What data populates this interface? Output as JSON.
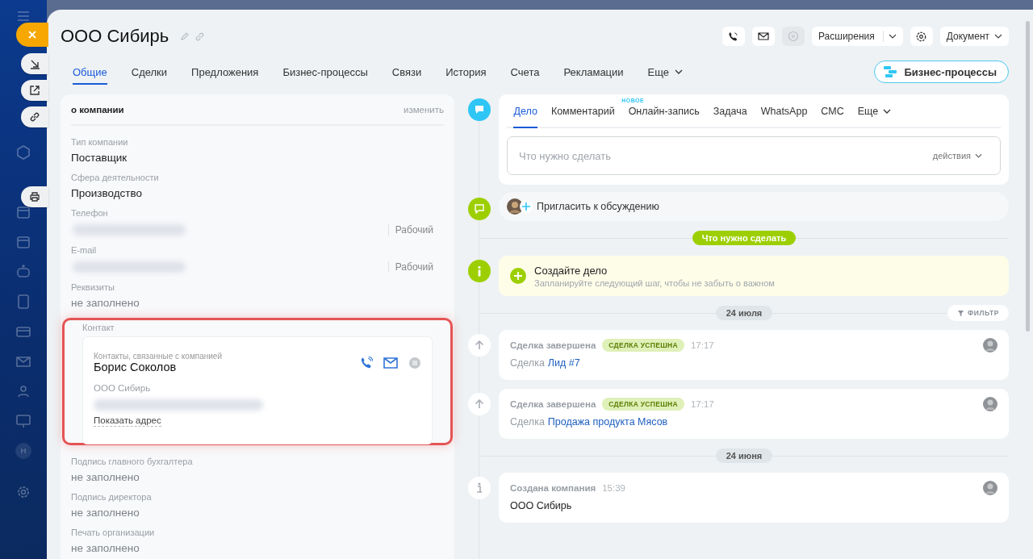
{
  "sidebar": {
    "user_initial": "Н"
  },
  "header": {
    "title": "ООО Сибирь",
    "extensions_button": "Расширения",
    "document_button": "Документ"
  },
  "tabs": [
    {
      "label": "Общие",
      "selected": true
    },
    {
      "label": "Сделки",
      "selected": false
    },
    {
      "label": "Предложения",
      "selected": false
    },
    {
      "label": "Бизнес-процессы",
      "selected": false
    },
    {
      "label": "Связи",
      "selected": false
    },
    {
      "label": "История",
      "selected": false
    },
    {
      "label": "Счета",
      "selected": false
    },
    {
      "label": "Рекламации",
      "selected": false
    },
    {
      "label": "Еще",
      "selected": false,
      "kind": "more"
    }
  ],
  "business_process_button": "Бизнес-процессы",
  "about": {
    "title": "о компании",
    "edit": "изменить",
    "fields": [
      {
        "kind": "text",
        "label": "Тип компании",
        "value": "Поставщик"
      },
      {
        "kind": "text",
        "label": "Сфера деятельности",
        "value": "Производство"
      },
      {
        "kind": "masked",
        "label": "Телефон",
        "type": "Рабочий"
      },
      {
        "kind": "masked",
        "label": "E-mail",
        "type": "Рабочий"
      },
      {
        "kind": "empty",
        "label": "Реквизиты",
        "value": "не заполнено"
      },
      {
        "kind": "contact",
        "label": "Контакт",
        "highlighted": true,
        "caption": "Контакты, связанные с компанией",
        "name": "Борис Соколов",
        "company": "ООО Сибирь",
        "link": "Показать адрес"
      },
      {
        "kind": "empty",
        "label": "Подпись главного бухгалтера",
        "value": "не заполнено"
      },
      {
        "kind": "empty",
        "label": "Подпись директора",
        "value": "не заполнено"
      },
      {
        "kind": "empty",
        "label": "Печать организации",
        "value": "не заполнено"
      }
    ]
  },
  "composer": {
    "tabs": [
      {
        "label": "Дело",
        "selected": true
      },
      {
        "label": "Комментарий",
        "selected": false
      },
      {
        "label": "Онлайн-запись",
        "selected": false,
        "badge": "НОВОЕ"
      },
      {
        "label": "Задача",
        "selected": false
      },
      {
        "label": "WhatsApp",
        "selected": false
      },
      {
        "label": "СМС",
        "selected": false
      },
      {
        "label": "Еще",
        "selected": false,
        "kind": "more"
      }
    ],
    "placeholder": "Что нужно сделать",
    "actions": "действия"
  },
  "invite": "Пригласить к обсуждению",
  "todo_section": "Что нужно сделать",
  "create": {
    "title": "Создайте дело",
    "subtitle": "Запланируйте следующий шаг, чтобы не забыть о важном"
  },
  "history": [
    {
      "kind": "date",
      "label": "24 июля",
      "filter": "ФИЛЬТР"
    },
    {
      "kind": "deal",
      "title": "Сделка завершена",
      "badge": "СДЕЛКА УСПЕШНА",
      "time": "17:17",
      "prefix": "Сделка",
      "link": "Лид #7"
    },
    {
      "kind": "deal",
      "title": "Сделка завершена",
      "badge": "СДЕЛКА УСПЕШНА",
      "time": "17:17",
      "prefix": "Сделка",
      "link": "Продажа продукта Мясов"
    },
    {
      "kind": "date",
      "label": "24 июня"
    },
    {
      "kind": "info",
      "title": "Создана компания",
      "time": "15:39",
      "text": "ООО Сибирь"
    }
  ]
}
